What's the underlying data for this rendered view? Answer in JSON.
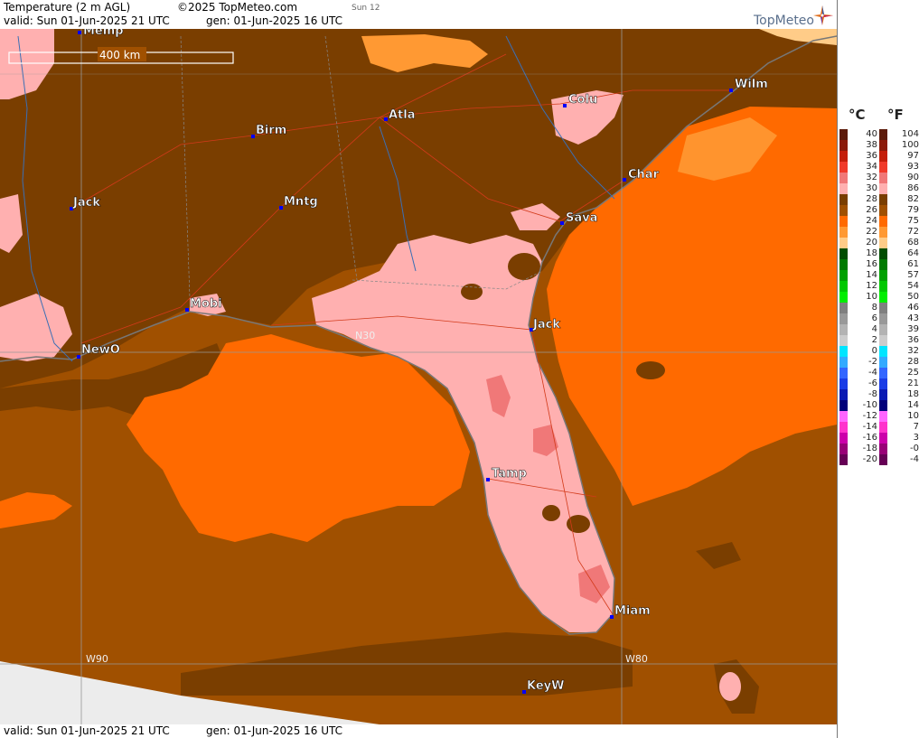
{
  "header": {
    "title": "Temperature (2 m AGL)",
    "copyright": "©2025 TopMeteo.com",
    "day_code": "Sun 12",
    "valid": "valid:  Sun  01-Jun-2025  21 UTC",
    "gen": "gen: 01-Jun-2025 16 UTC"
  },
  "logo": {
    "text": "TopMeteo",
    "icon": "compass-star-icon"
  },
  "map": {
    "scale_label": "400 km",
    "grid_labels": [
      "N30",
      "W90",
      "W80"
    ],
    "cities": [
      "Memp",
      "Birm",
      "Atla",
      "Colu",
      "Wilm",
      "Char",
      "Jack",
      "Mntg",
      "Sava",
      "Mobi",
      "Jack",
      "NewO",
      "Tamp",
      "Miam",
      "KeyW"
    ],
    "colors": {
      "brown": "#a05000",
      "dark_brown": "#7a3e00",
      "orange": "#ff6a00",
      "pink": "#ffb0b0",
      "light_orange": "#ff9933",
      "no_data": "#ececec"
    }
  },
  "footer": {
    "valid": "valid:  Sun  01-Jun-2025  21 UTC",
    "gen": "gen: 01-Jun-2025 16 UTC"
  },
  "legend": {
    "unit_c": "°C",
    "unit_f": "°F",
    "rows": [
      {
        "c": "40",
        "f": "104",
        "color": "#5c1a0a"
      },
      {
        "c": "38",
        "f": "100",
        "color": "#8b1a0a"
      },
      {
        "c": "36",
        "f": "97",
        "color": "#c41e0a"
      },
      {
        "c": "34",
        "f": "93",
        "color": "#f03a2a"
      },
      {
        "c": "32",
        "f": "90",
        "color": "#f07878"
      },
      {
        "c": "30",
        "f": "86",
        "color": "#ffb0b0"
      },
      {
        "c": "28",
        "f": "82",
        "color": "#7a3e00"
      },
      {
        "c": "26",
        "f": "79",
        "color": "#a05000"
      },
      {
        "c": "24",
        "f": "75",
        "color": "#ff6a00"
      },
      {
        "c": "22",
        "f": "72",
        "color": "#ff9933"
      },
      {
        "c": "20",
        "f": "68",
        "color": "#ffcc88"
      },
      {
        "c": "18",
        "f": "64",
        "color": "#004d00"
      },
      {
        "c": "16",
        "f": "61",
        "color": "#007a00"
      },
      {
        "c": "14",
        "f": "57",
        "color": "#00a000"
      },
      {
        "c": "12",
        "f": "54",
        "color": "#00c800"
      },
      {
        "c": "10",
        "f": "50",
        "color": "#00ee00"
      },
      {
        "c": "8",
        "f": "46",
        "color": "#808080"
      },
      {
        "c": "6",
        "f": "43",
        "color": "#999999"
      },
      {
        "c": "4",
        "f": "39",
        "color": "#b3b3b3"
      },
      {
        "c": "2",
        "f": "36",
        "color": "#cccccc"
      },
      {
        "c": "0",
        "f": "32",
        "color": "#00e5ff"
      },
      {
        "c": "-2",
        "f": "28",
        "color": "#33aaff"
      },
      {
        "c": "-4",
        "f": "25",
        "color": "#3366ff"
      },
      {
        "c": "-6",
        "f": "21",
        "color": "#1a3ce6"
      },
      {
        "c": "-8",
        "f": "18",
        "color": "#0a1ab3"
      },
      {
        "c": "-10",
        "f": "14",
        "color": "#00007a"
      },
      {
        "c": "-12",
        "f": "10",
        "color": "#ff66ff"
      },
      {
        "c": "-14",
        "f": "7",
        "color": "#ff33cc"
      },
      {
        "c": "-16",
        "f": "3",
        "color": "#cc00aa"
      },
      {
        "c": "-18",
        "f": "-0",
        "color": "#990077"
      },
      {
        "c": "-20",
        "f": "-4",
        "color": "#660055"
      }
    ]
  }
}
